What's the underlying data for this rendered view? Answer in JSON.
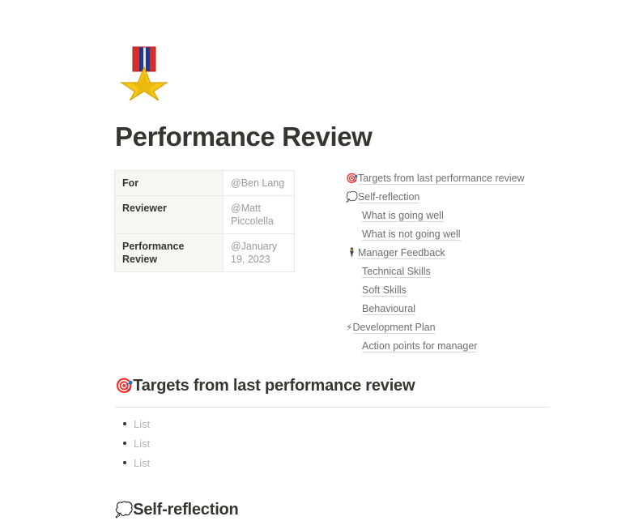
{
  "document": {
    "icon": "military-medal-emoji",
    "title": "Performance Review"
  },
  "properties": {
    "rows": [
      {
        "key": "For",
        "value": "@Ben Lang"
      },
      {
        "key": "Reviewer",
        "value": "@Matt Piccolella"
      },
      {
        "key": "Performance Review",
        "value": "@January 19, 2023"
      }
    ]
  },
  "table_of_contents": {
    "items": [
      {
        "emoji": "🎯",
        "label": "Targets from last performance review",
        "level": 1
      },
      {
        "emoji": "💭",
        "label": "Self-reflection",
        "level": 1
      },
      {
        "emoji": "",
        "label": "What is going well",
        "level": 2
      },
      {
        "emoji": "",
        "label": "What is not going well",
        "level": 2
      },
      {
        "emoji": "🕴",
        "label": "Manager Feedback",
        "level": 1
      },
      {
        "emoji": "",
        "label": "Technical Skills",
        "level": 2
      },
      {
        "emoji": "",
        "label": "Soft Skills",
        "level": 2
      },
      {
        "emoji": "",
        "label": "Behavioural",
        "level": 2
      },
      {
        "emoji": "⚡",
        "label": "Development Plan",
        "level": 1
      },
      {
        "emoji": "",
        "label": "Action points for manager",
        "level": 2
      }
    ]
  },
  "sections": {
    "targets": {
      "emoji": "🎯",
      "heading": "Targets from last performance review",
      "bullets": [
        "List",
        "List",
        "List"
      ]
    },
    "self_reflection": {
      "emoji": "💭",
      "heading": "Self-reflection"
    }
  },
  "colors": {
    "text": "#37352f",
    "muted": "#9b9a97",
    "placeholder": "#b6b5b2",
    "border": "#e9e9e7",
    "header_cell_bg": "#f7f6f3",
    "divider": "#e3e2e0"
  }
}
